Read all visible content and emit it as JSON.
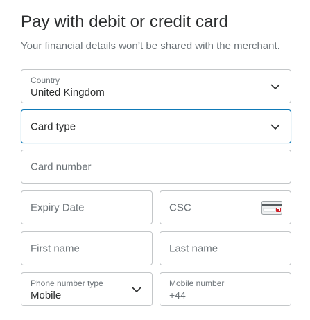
{
  "header": {
    "title": "Pay with debit or credit card",
    "subtitle": "Your financial details won’t be shared with the merchant."
  },
  "form": {
    "country": {
      "label": "Country",
      "value": "United Kingdom"
    },
    "card_type": {
      "placeholder": "Card type"
    },
    "card_number": {
      "placeholder": "Card number"
    },
    "expiry": {
      "placeholder": "Expiry Date"
    },
    "csc": {
      "placeholder": "CSC",
      "icon": "card-back-icon"
    },
    "first_name": {
      "placeholder": "First name"
    },
    "last_name": {
      "placeholder": "Last name"
    },
    "phone_type": {
      "label": "Phone number type",
      "value": "Mobile"
    },
    "mobile": {
      "label": "Mobile number",
      "value": "+44"
    }
  },
  "colors": {
    "focus_border": "#0f7ab8",
    "border": "#c4c7c9",
    "text": "#2c2e2f",
    "muted": "#6c7378"
  }
}
